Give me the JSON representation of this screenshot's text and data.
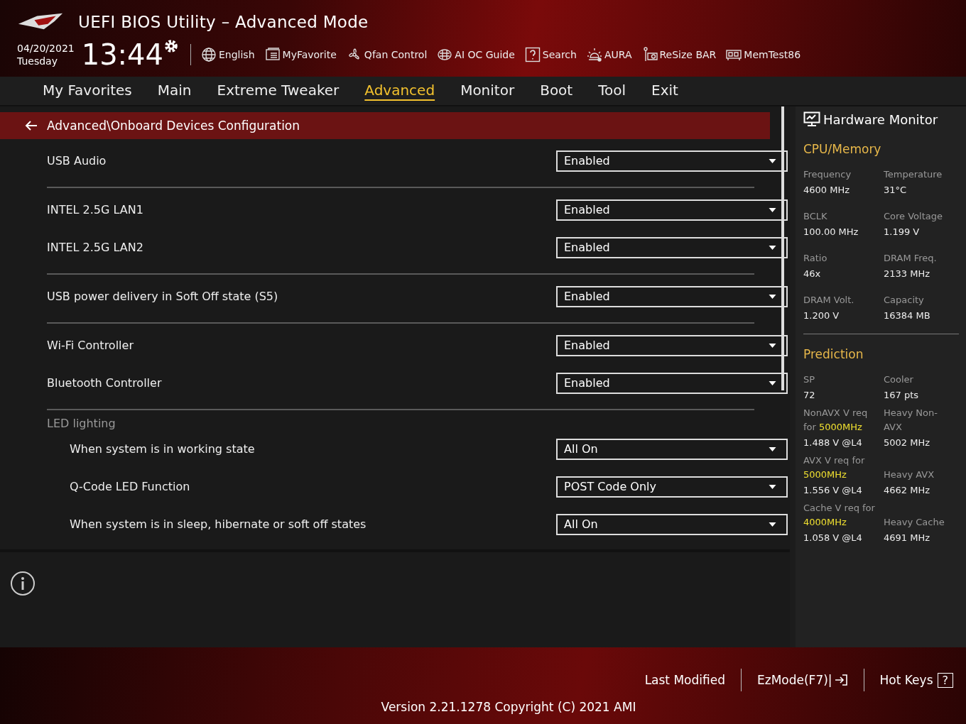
{
  "header": {
    "title": "UEFI BIOS Utility – Advanced Mode",
    "date": "04/20/2021",
    "day": "Tuesday",
    "time": "13:44",
    "tools": [
      {
        "label": "English",
        "kind": "globe"
      },
      {
        "label": "MyFavorite",
        "kind": "list"
      },
      {
        "label": "Qfan Control",
        "kind": "fan"
      },
      {
        "label": "AI OC Guide",
        "kind": "chip"
      },
      {
        "label": "Search",
        "kind": "help"
      },
      {
        "label": "AURA",
        "kind": "light"
      },
      {
        "label": "ReSize BAR",
        "kind": "card"
      },
      {
        "label": "MemTest86",
        "kind": "memory"
      }
    ]
  },
  "tabs": [
    {
      "label": "My Favorites",
      "selected": false
    },
    {
      "label": "Main",
      "selected": false
    },
    {
      "label": "Extreme Tweaker",
      "selected": false
    },
    {
      "label": "Advanced",
      "selected": true
    },
    {
      "label": "Monitor",
      "selected": false
    },
    {
      "label": "Boot",
      "selected": false
    },
    {
      "label": "Tool",
      "selected": false
    },
    {
      "label": "Exit",
      "selected": false
    }
  ],
  "breadcrumb": "Advanced\\Onboard Devices Configuration",
  "groups": [
    {
      "items": [
        {
          "kind": "setting",
          "label": "USB Audio",
          "value": "Enabled"
        }
      ]
    },
    {
      "items": [
        {
          "kind": "setting",
          "label": "INTEL 2.5G LAN1",
          "value": "Enabled"
        },
        {
          "kind": "setting",
          "label": "INTEL 2.5G LAN2",
          "value": "Enabled"
        }
      ]
    },
    {
      "items": [
        {
          "kind": "setting",
          "label": "USB power delivery in Soft Off state (S5)",
          "value": "Enabled"
        }
      ]
    },
    {
      "items": [
        {
          "kind": "setting",
          "label": "Wi-Fi Controller",
          "value": "Enabled"
        },
        {
          "kind": "setting",
          "label": "Bluetooth Controller",
          "value": "Enabled"
        }
      ]
    },
    {
      "items": [
        {
          "kind": "heading",
          "label": "LED lighting",
          "children": [
            {
              "kind": "setting",
              "label": "When system is in working state",
              "value": "All On"
            },
            {
              "kind": "setting",
              "label": "Q-Code LED Function",
              "value": "POST Code Only"
            },
            {
              "kind": "setting",
              "label": "When system is in sleep, hibernate or soft off states",
              "value": "All On"
            }
          ]
        }
      ]
    }
  ],
  "monitor": {
    "title": "Hardware Monitor",
    "sections": [
      {
        "title": "CPU/Memory",
        "cells": [
          {
            "label": "Frequency",
            "value": "4600 MHz"
          },
          {
            "label": "Temperature",
            "value": "31°C"
          },
          {
            "label": "BCLK",
            "value": "100.00 MHz"
          },
          {
            "label": "Core Voltage",
            "value": "1.199 V"
          },
          {
            "label": "Ratio",
            "value": "46x"
          },
          {
            "label": "DRAM Freq.",
            "value": "2133 MHz"
          },
          {
            "label": "DRAM Volt.",
            "value": "1.200 V"
          },
          {
            "label": "Capacity",
            "value": "16384 MB"
          }
        ]
      },
      {
        "title": "Prediction",
        "cells": [
          {
            "label": "SP",
            "value": "72"
          },
          {
            "label": "Cooler",
            "value": "167 pts"
          },
          {
            "label": "NonAVX V req for **5000MHz**",
            "value": "1.488 V @L4"
          },
          {
            "label": "Heavy Non-AVX",
            "value": "5002 MHz"
          },
          {
            "label": "AVX V req for **5000MHz**",
            "value": "1.556 V @L4"
          },
          {
            "label": "Heavy AVX",
            "value": "4662 MHz"
          },
          {
            "label": "Cache V req for **4000MHz**",
            "value": "1.058 V @L4"
          },
          {
            "label": "Heavy Cache",
            "value": "4691 MHz"
          }
        ]
      }
    ]
  },
  "footer": {
    "buttons": [
      {
        "label": "Last Modified",
        "kind": "plain"
      },
      {
        "label": "EzMode(F7)|",
        "kind": "exit"
      },
      {
        "label": "Hot Keys",
        "kind": "help"
      }
    ],
    "help_icon": "?",
    "version": "Version 2.21.1278 Copyright (C) 2021 AMI"
  }
}
